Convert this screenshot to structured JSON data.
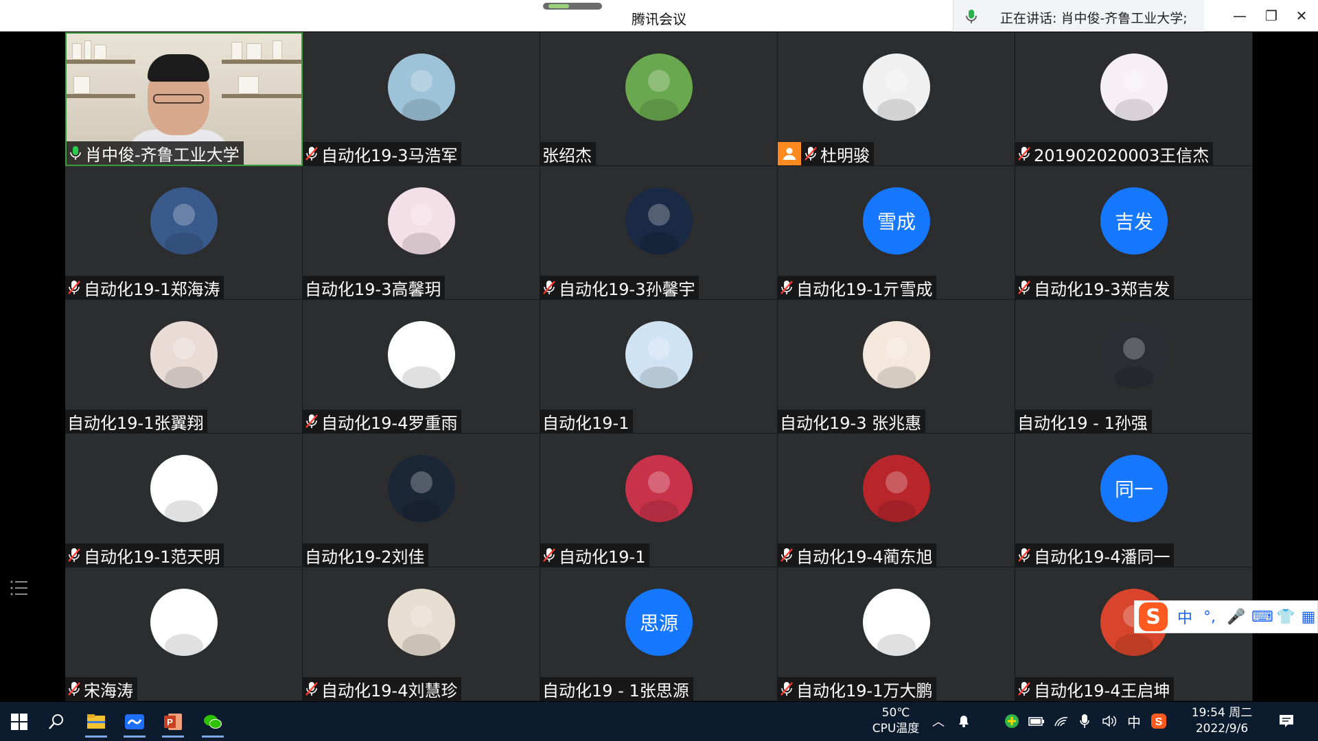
{
  "window": {
    "title": "腾讯会议",
    "speaking_text": "正在讲话: 肖中俊-齐鲁工业大学;",
    "minimize_label": "—",
    "restore_label": "❐",
    "close_label": "✕"
  },
  "participants": [
    {
      "name": "肖中俊-齐鲁工业大学",
      "mic": "on",
      "avatar_type": "video"
    },
    {
      "name": "自动化19-3马浩军",
      "mic": "muted",
      "avatar_type": "image",
      "color": "#9ec3d8",
      "icon": "bird-photo-icon"
    },
    {
      "name": "张绍杰",
      "mic": "none",
      "avatar_type": "image",
      "color": "#6aa84f",
      "icon": "mountain-landscape-icon"
    },
    {
      "name": "杜明骏",
      "mic": "muted",
      "avatar_type": "image",
      "color": "#f0f0f0",
      "icon": "fox-cartoon-icon",
      "camera_off": true
    },
    {
      "name": "201902020003王信杰",
      "mic": "muted",
      "avatar_type": "image",
      "color": "#f6f0f4",
      "icon": "pink-dinosaur-icon"
    },
    {
      "name": "自动化19-1郑海涛",
      "mic": "muted",
      "avatar_type": "image",
      "color": "#3a5a8c",
      "icon": "goku-cartoon-icon"
    },
    {
      "name": "自动化19-3高馨玥",
      "mic": "none",
      "avatar_type": "image",
      "color": "#f3dfe6",
      "icon": "girl-reading-icon"
    },
    {
      "name": "自动化19-3孙馨宇",
      "mic": "muted",
      "avatar_type": "image",
      "color": "#1a2a44",
      "icon": "angel-cartoon-icon"
    },
    {
      "name": "自动化19-1亓雪成",
      "mic": "muted",
      "avatar_type": "text",
      "text": "雪成",
      "color": "#1677ff"
    },
    {
      "name": "自动化19-3郑吉发",
      "mic": "muted",
      "avatar_type": "text",
      "text": "吉发",
      "color": "#1677ff"
    },
    {
      "name": "自动化19-1张翼翔",
      "mic": "none",
      "avatar_type": "image",
      "color": "#e9dcd6",
      "icon": "portrait-drawing-icon"
    },
    {
      "name": "自动化19-4罗重雨",
      "mic": "muted",
      "avatar_type": "image",
      "color": "#ffffff",
      "icon": "cartoon-face-icon"
    },
    {
      "name": "自动化19-1",
      "mic": "none",
      "avatar_type": "image",
      "color": "#cfe3f3",
      "icon": "anime-boy-icon"
    },
    {
      "name": "自动化19-3 张兆惠",
      "mic": "none",
      "avatar_type": "image",
      "color": "#f4e7dc",
      "icon": "couple-cartoon-icon"
    },
    {
      "name": "自动化19 - 1孙强",
      "mic": "none",
      "avatar_type": "image",
      "color": "#2a2d33",
      "icon": "dark-abstract-icon"
    },
    {
      "name": "自动化19-1范天明",
      "mic": "muted",
      "avatar_type": "image",
      "color": "#ffffff",
      "icon": "blank-white-icon"
    },
    {
      "name": "自动化19-2刘佳",
      "mic": "none",
      "avatar_type": "image",
      "color": "#1b2636",
      "icon": "moon-night-icon"
    },
    {
      "name": "自动化19-1",
      "mic": "muted",
      "avatar_type": "image",
      "color": "#c9334a",
      "icon": "tulip-field-icon"
    },
    {
      "name": "自动化19-4蔺东旭",
      "mic": "muted",
      "avatar_type": "image",
      "color": "#b8262c",
      "icon": "figure-photo-icon"
    },
    {
      "name": "自动化19-4潘同一",
      "mic": "muted",
      "avatar_type": "text",
      "text": "同一",
      "color": "#1677ff"
    },
    {
      "name": "宋海涛",
      "mic": "muted",
      "avatar_type": "image",
      "color": "#ffffff",
      "icon": "crayon-shinchan-icon"
    },
    {
      "name": "自动化19-4刘慧珍",
      "mic": "muted",
      "avatar_type": "image",
      "color": "#e7ddd0",
      "icon": "anime-couple-icon"
    },
    {
      "name": "自动化19 - 1张思源",
      "mic": "none",
      "avatar_type": "text",
      "text": "思源",
      "color": "#1677ff"
    },
    {
      "name": "自动化19-1万大鹏",
      "mic": "muted",
      "avatar_type": "image",
      "color": "#ffffff",
      "icon": "eye-sketch-icon"
    },
    {
      "name": "自动化19-4王启坤",
      "mic": "muted",
      "avatar_type": "image",
      "color": "#d8452c",
      "icon": "red-cartoon-icon"
    }
  ],
  "ime": {
    "logo": "S",
    "items": [
      "中",
      "°,",
      "🎤",
      "⌨",
      "👕",
      "▦"
    ]
  },
  "taskbar": {
    "cpu_temp": "50℃",
    "cpu_label": "CPU温度",
    "ime_lang": "中",
    "time": "19:54 周二",
    "date": "2022/9/6"
  }
}
